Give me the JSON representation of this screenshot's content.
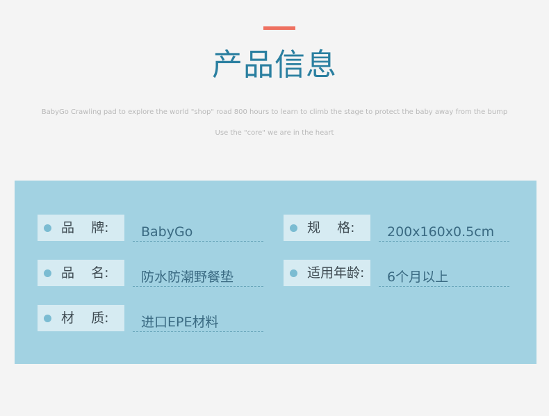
{
  "header": {
    "title": "产品信息",
    "subtitle_line1": "BabyGo Crawling pad to explore the world \"shop\" road 800 hours to learn to climb the stage to protect the baby away from the bump",
    "subtitle_line2": "Use the \"core\" we are in the heart",
    "accent_color": "#ee7060",
    "title_color": "#2a7fa0"
  },
  "panel": {
    "background_color": "#a2d2e2",
    "fields": [
      {
        "label": "品    牌:",
        "value": "BabyGo"
      },
      {
        "label": "规    格:",
        "value": "200x160x0.5cm"
      },
      {
        "label": "品    名:",
        "value": "防水防潮野餐垫"
      },
      {
        "label": "适用年龄:",
        "value": "6个月以上"
      },
      {
        "label": "材    质:",
        "value": "进口EPE材料"
      }
    ]
  }
}
